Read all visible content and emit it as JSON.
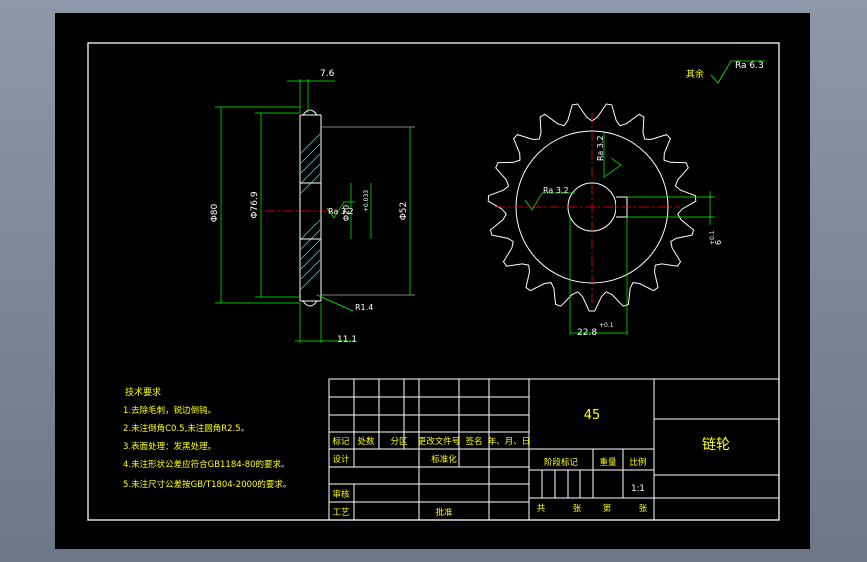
{
  "colors": {
    "background": "#000000",
    "border": "#ffffff",
    "dimension": "#00ff00",
    "text_cn": "#ffff00",
    "centerline": "#ff0000",
    "hatch": "#00ffff",
    "outline": "#ffffff"
  },
  "surface_finish": {
    "label": "其余",
    "value": "Ra 6.3"
  },
  "side_view": {
    "dims": {
      "top_width": "7.6",
      "outer_dia": "Φ80",
      "root_dia": "Φ76.9",
      "hub_bore": "Φ20",
      "bore_tol": "+0.033",
      "hub_dia": "Φ52",
      "roughness": "Ra 3.2",
      "radius": "R1.4",
      "bottom_width": "11.1"
    }
  },
  "front_view": {
    "roughness_top": "Ra 3.2",
    "roughness_left": "Ra 3.2",
    "key_width": "6",
    "key_tol": "+0.1",
    "keyway_depth": "22.8",
    "keyway_tol": "+0.1",
    "teeth": 19
  },
  "tech_req": {
    "title": "技术要求",
    "items": [
      "1.去除毛刺，锐边倒钝。",
      "2.未注倒角C0.5,未注圆角R2.5。",
      "3.表面处理：发黑处理。",
      "4.未注形状公差应符合GB1184-80的要求。",
      "5.未注尺寸公差按GB/T1804-2000的要求。"
    ]
  },
  "title_block": {
    "material": "45",
    "part_name": "链轮",
    "headers": [
      "标记",
      "处数",
      "分区",
      "更改文件号",
      "签名",
      "年、月、日"
    ],
    "design": "设计",
    "standardize": "标准化",
    "review": "审核",
    "process": "工艺",
    "approve": "批准",
    "stage_mark": "阶段标记",
    "weight": "重量",
    "scale_label": "比例",
    "scale": "1:1",
    "total": "共",
    "sheet": "张",
    "number": "第",
    "sheet2": "张"
  }
}
